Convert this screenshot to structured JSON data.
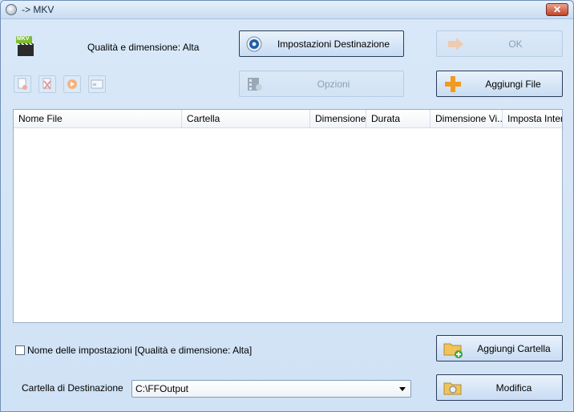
{
  "window": {
    "title": "-> MKV",
    "close_label": "✕"
  },
  "quality_label": "Qualità e dimensione: Alta",
  "buttons": {
    "impostazioni": "Impostazioni Destinazione",
    "ok": "OK",
    "opzioni": "Opzioni",
    "aggiungi_file": "Aggiungi File",
    "aggiungi_cartella": "Aggiungi Cartella",
    "modifica": "Modifica"
  },
  "format_badge": "MKV",
  "table": {
    "columns": [
      "Nome File",
      "Cartella",
      "Dimensione",
      "Durata",
      "Dimensione Vi...",
      "Imposta Interv"
    ]
  },
  "checkbox_label": "Nome delle impostazioni [Qualità e dimensione: Alta]",
  "dest": {
    "label": "Cartella di Destinazione",
    "value": "C:\\FFOutput"
  },
  "colors": {
    "accent_orange": "#f39a1e",
    "window_bg": "#d6e6f7",
    "close_red": "#c0442b"
  }
}
